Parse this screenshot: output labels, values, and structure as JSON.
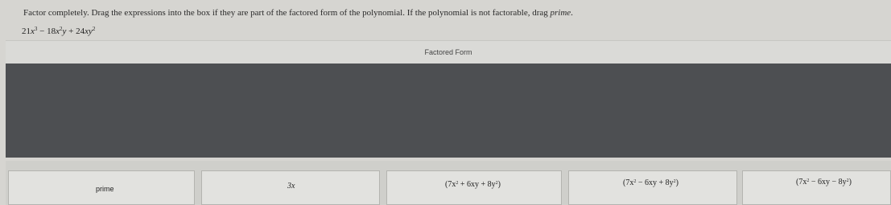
{
  "question": {
    "instruction": "Factor completely. Drag the expressions into the box if they are part of the factored form of the polynomial. If the polynomial is not factorable, drag ",
    "instruction_prime_word": "prime",
    "instruction_end": ".",
    "polynomial": {
      "t1_coef": "21",
      "t1_var": "x",
      "t1_exp": "3",
      "op1": " − ",
      "t2_coef": "18",
      "t2_var1": "x",
      "t2_exp1": "2",
      "t2_var2": "y",
      "op2": " + ",
      "t3_coef": "24",
      "t3_var1": "x",
      "t3_var2": "y",
      "t3_exp2": "2"
    }
  },
  "dropzone": {
    "header": "Factored Form"
  },
  "tiles": [
    {
      "id": "prime",
      "text": "prime"
    },
    {
      "id": "3x",
      "text": "3x"
    },
    {
      "id": "f1",
      "a": "(7x",
      "e1": "2",
      "b": " + 6xy + 8y",
      "e2": "2",
      "c": ")"
    },
    {
      "id": "f2",
      "a": "(7x",
      "e1": "2",
      "b": " − 6xy + 8y",
      "e2": "2",
      "c": ")"
    },
    {
      "id": "f3",
      "a": "(7x",
      "e1": "2",
      "b": " − 6xy − 8y",
      "e2": "2",
      "c": ")"
    }
  ]
}
